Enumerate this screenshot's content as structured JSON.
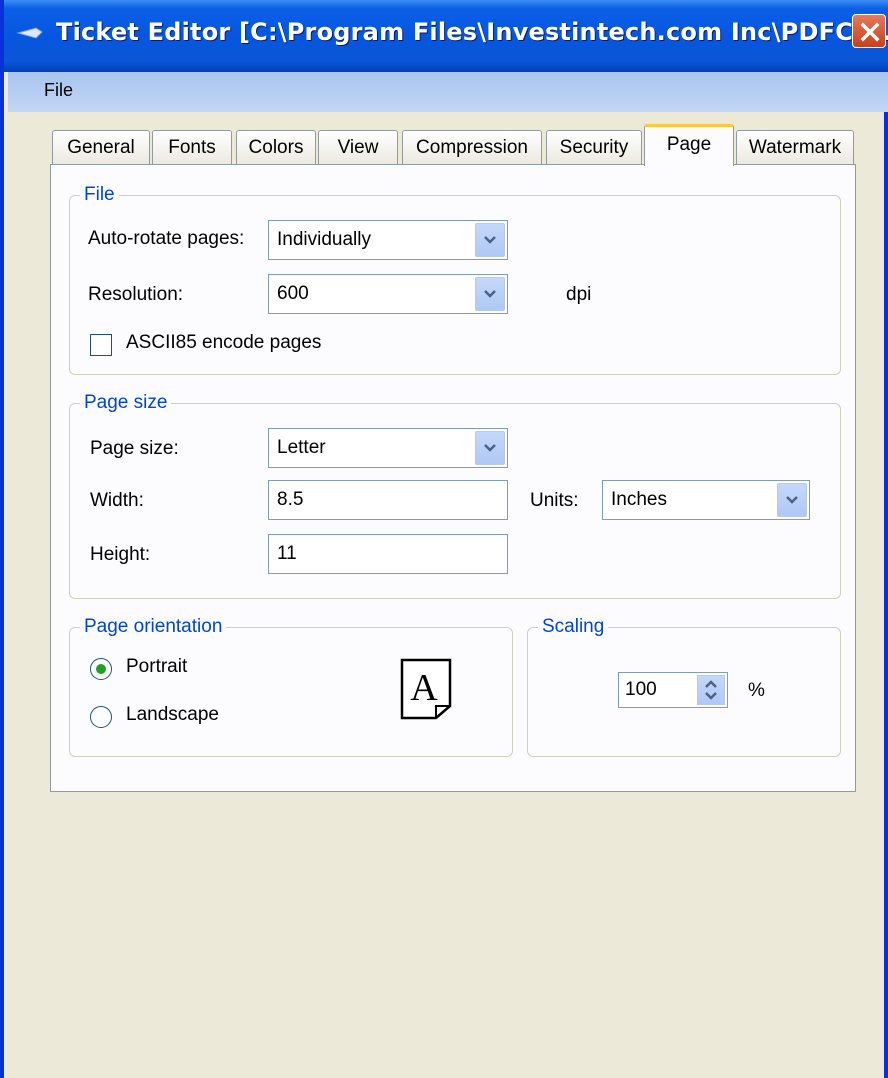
{
  "window": {
    "title": "Ticket Editor [C:\\Program Files\\Investintech.com Inc\\PDFCre...",
    "title_icon": "app-icon",
    "close_icon": "close-icon"
  },
  "menu": {
    "file": "File"
  },
  "tabs": [
    {
      "label": "General",
      "active": false
    },
    {
      "label": "Fonts",
      "active": false
    },
    {
      "label": "Colors",
      "active": false
    },
    {
      "label": "View",
      "active": false
    },
    {
      "label": "Compression",
      "active": false
    },
    {
      "label": "Security",
      "active": false
    },
    {
      "label": "Page",
      "active": true
    },
    {
      "label": "Watermark",
      "active": false
    }
  ],
  "file_group": {
    "title": "File",
    "auto_rotate_label": "Auto-rotate pages:",
    "auto_rotate_value": "Individually",
    "resolution_label": "Resolution:",
    "resolution_value": "600",
    "resolution_unit": "dpi",
    "ascii85_label": "ASCII85 encode pages",
    "ascii85_checked": false
  },
  "page_size_group": {
    "title": "Page size",
    "page_size_label": "Page size:",
    "page_size_value": "Letter",
    "width_label": "Width:",
    "width_value": "8.5",
    "units_label": "Units:",
    "units_value": "Inches",
    "height_label": "Height:",
    "height_value": "11"
  },
  "orientation_group": {
    "title": "Page orientation",
    "portrait_label": "Portrait",
    "landscape_label": "Landscape",
    "selected": "Portrait",
    "preview_letter": "A"
  },
  "scaling_group": {
    "title": "Scaling",
    "value": "100",
    "unit": "%"
  },
  "colors": {
    "titlebar": "#0756df",
    "group_title": "#0046d5",
    "active_tab_highlight": "#ffc83c",
    "radio_selected": "#21a121"
  }
}
